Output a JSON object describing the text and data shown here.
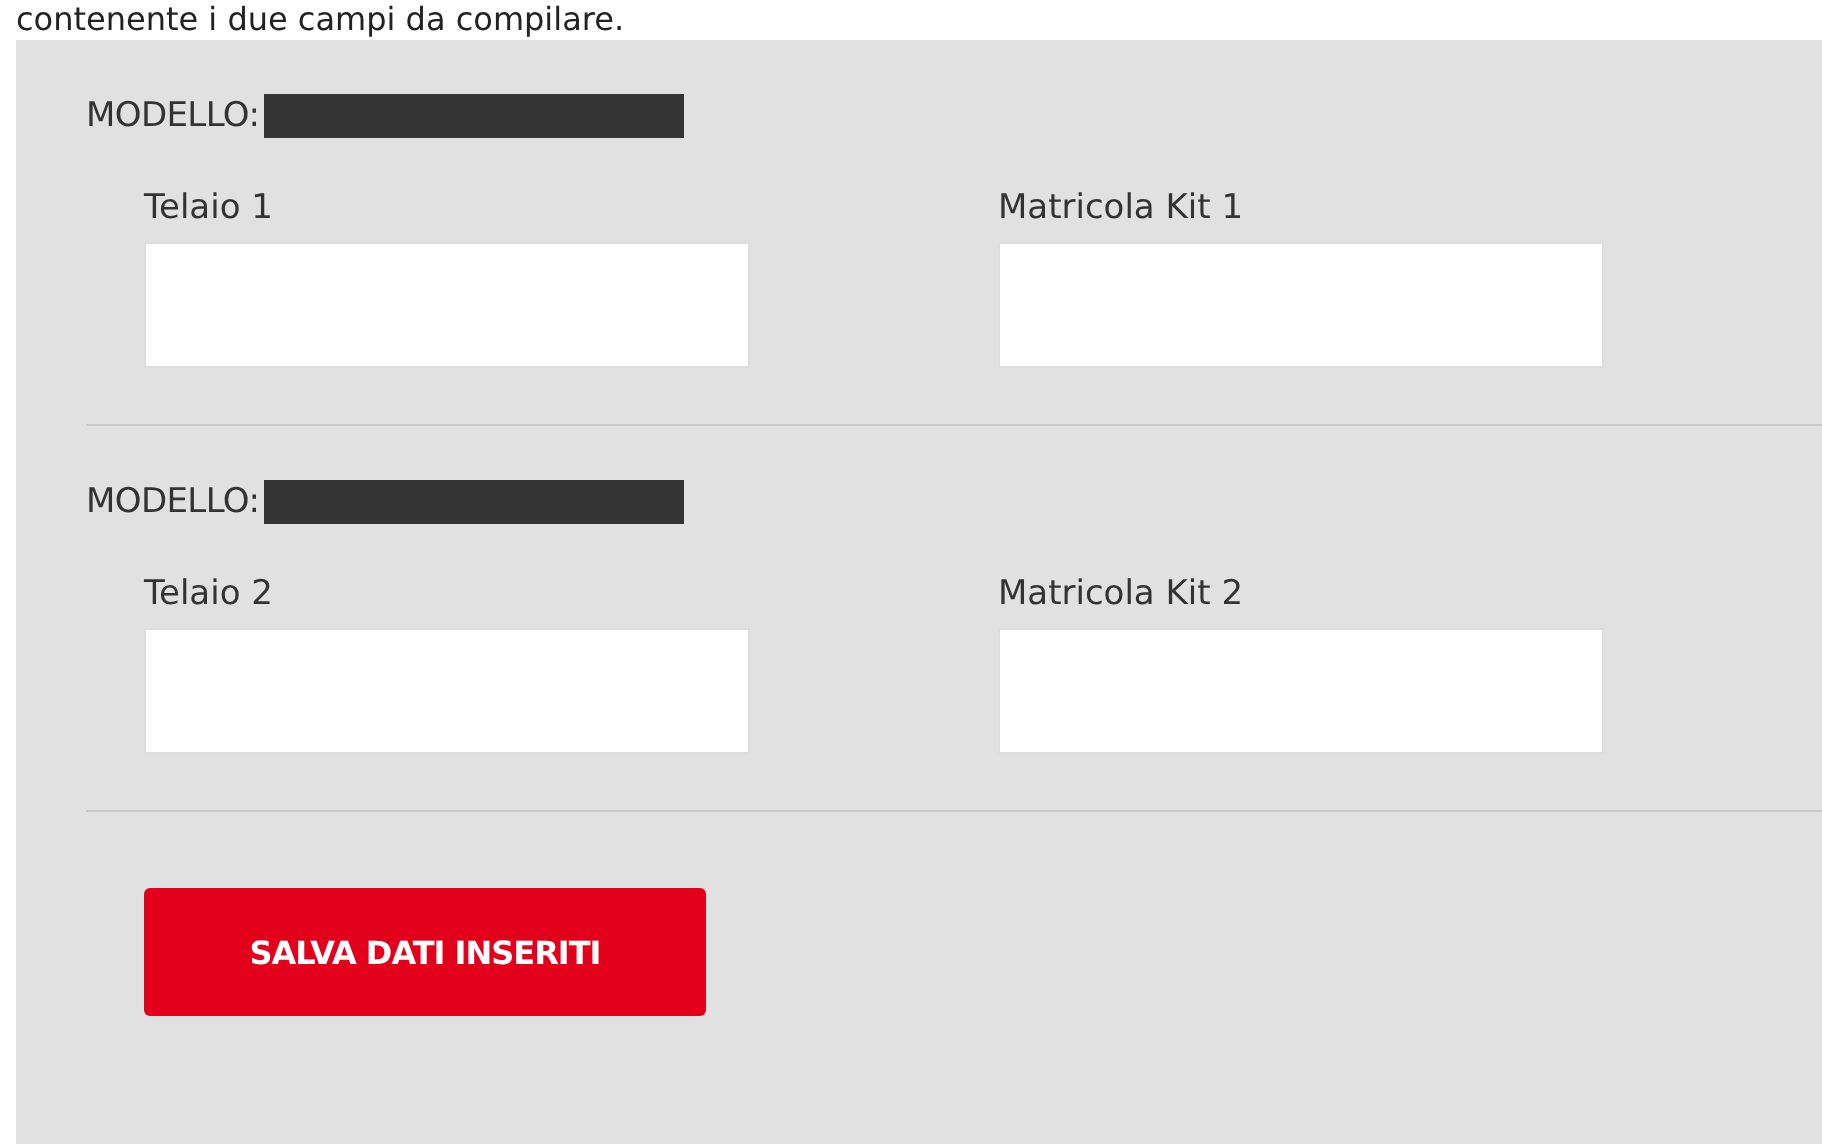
{
  "intro": "contenente i due campi da compilare.",
  "sections": [
    {
      "model_label": "MODELLO:",
      "model_redacted": true,
      "fields": [
        {
          "label": "Telaio 1"
        },
        {
          "label": "Matricola Kit 1"
        }
      ]
    },
    {
      "model_label": "MODELLO:",
      "model_redacted": true,
      "fields": [
        {
          "label": "Telaio 2"
        },
        {
          "label": "Matricola Kit 2"
        }
      ]
    }
  ],
  "save_button": "SALVA DATI INSERITI"
}
